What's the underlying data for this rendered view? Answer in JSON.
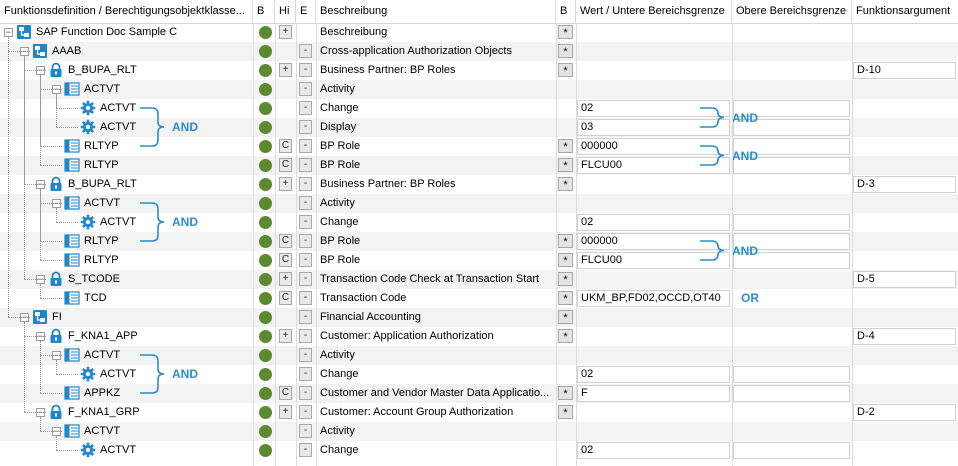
{
  "columns": {
    "name": "Funktionsdefinition / Berechtigungsobjektklasse...",
    "b": "B",
    "hi": "Hi",
    "e": "E",
    "desc": "Beschreibung",
    "b2": "B",
    "lower": "Wert / Untere Bereichsgrenze",
    "upper": "Obere Bereichsgrenze",
    "arg": "Funktionsargument"
  },
  "rows": [
    {
      "name": "SAP Function Doc Sample C",
      "icon": "function-icon",
      "level": 0,
      "hi": "+",
      "desc": "Beschreibung",
      "star": true,
      "lower": "",
      "upper": "",
      "arg": "",
      "lowerField": false,
      "upperField": false,
      "argField": false
    },
    {
      "name": "AAAB",
      "icon": "class-icon",
      "level": 1,
      "hi": "",
      "e": "-",
      "desc": "Cross-application Authorization Objects",
      "star": true
    },
    {
      "name": "B_BUPA_RLT",
      "icon": "lock-icon",
      "level": 2,
      "hi": "+",
      "e": "-",
      "desc": "Business Partner: BP Roles",
      "star": true,
      "arg": "D-10",
      "argField": true
    },
    {
      "name": "ACTVT",
      "icon": "field-icon",
      "level": 3,
      "e": "-",
      "desc": "Activity"
    },
    {
      "name": "ACTVT",
      "icon": "gear-icon",
      "level": 4,
      "e": "-",
      "desc": "Change",
      "lower": "02",
      "lowerField": true,
      "upperField": true
    },
    {
      "name": "ACTVT",
      "icon": "gear-icon",
      "level": 4,
      "e": "-",
      "desc": "Display",
      "lower": "03",
      "lowerField": true,
      "upperField": true
    },
    {
      "name": "RLTYP",
      "icon": "field-icon",
      "level": 3,
      "hi": "C",
      "e": "-",
      "desc": "BP Role",
      "star": true,
      "lower": "000000",
      "lowerField": true,
      "upperField": true
    },
    {
      "name": "RLTYP",
      "icon": "field-icon",
      "level": 3,
      "hi": "C",
      "e": "-",
      "desc": "BP Role",
      "star": true,
      "lower": "FLCU00",
      "lowerField": true,
      "upperField": true
    },
    {
      "name": "B_BUPA_RLT",
      "icon": "lock-icon",
      "level": 2,
      "hi": "+",
      "e": "-",
      "desc": "Business Partner: BP Roles",
      "star": true,
      "arg": "D-3",
      "argField": true
    },
    {
      "name": "ACTVT",
      "icon": "field-icon",
      "level": 3,
      "e": "-",
      "desc": "Activity"
    },
    {
      "name": "ACTVT",
      "icon": "gear-icon",
      "level": 4,
      "e": "-",
      "desc": "Change",
      "lower": "02",
      "lowerField": true,
      "upperField": true
    },
    {
      "name": "RLTYP",
      "icon": "field-icon",
      "level": 3,
      "hi": "C",
      "e": "-",
      "desc": "BP Role",
      "star": true,
      "lower": "000000",
      "lowerField": true,
      "upperField": true
    },
    {
      "name": "RLTYP",
      "icon": "field-icon",
      "level": 3,
      "hi": "C",
      "e": "-",
      "desc": "BP Role",
      "star": true,
      "lower": "FLCU00",
      "lowerField": true,
      "upperField": true
    },
    {
      "name": "S_TCODE",
      "icon": "lock-icon",
      "level": 2,
      "hi": "+",
      "e": "-",
      "desc": "Transaction Code Check at Transaction Start",
      "star": true,
      "arg": "D-5",
      "argField": true
    },
    {
      "name": "TCD",
      "icon": "field-icon",
      "level": 3,
      "hi": "C",
      "e": "-",
      "desc": "Transaction Code",
      "star": true,
      "lower": "UKM_BP,FD02,OCCD,OT40",
      "lowerField": true
    },
    {
      "name": "FI",
      "icon": "class-icon",
      "level": 1,
      "e": "-",
      "desc": "Financial Accounting",
      "star": true
    },
    {
      "name": "F_KNA1_APP",
      "icon": "lock-icon",
      "level": 2,
      "hi": "+",
      "e": "-",
      "desc": "Customer: Application Authorization",
      "star": true,
      "arg": "D-4",
      "argField": true
    },
    {
      "name": "ACTVT",
      "icon": "field-icon",
      "level": 3,
      "e": "-",
      "desc": "Activity"
    },
    {
      "name": "ACTVT",
      "icon": "gear-icon",
      "level": 4,
      "e": "-",
      "desc": "Change",
      "lower": "02",
      "lowerField": true,
      "upperField": true
    },
    {
      "name": "APPKZ",
      "icon": "field-icon",
      "level": 3,
      "hi": "C",
      "e": "-",
      "desc": "Customer and Vendor Master Data Applicatio...",
      "star": true,
      "lower": "F",
      "lowerField": true,
      "upperField": true
    },
    {
      "name": "F_KNA1_GRP",
      "icon": "lock-icon",
      "level": 2,
      "hi": "+",
      "e": "-",
      "desc": "Customer: Account Group Authorization",
      "star": true,
      "arg": "D-2",
      "argField": true
    },
    {
      "name": "ACTVT",
      "icon": "field-icon",
      "level": 3,
      "e": "-",
      "desc": "Activity"
    },
    {
      "name": "ACTVT",
      "icon": "gear-icon",
      "level": 4,
      "e": "-",
      "desc": "Change",
      "lower": "02",
      "lowerField": true,
      "upperField": true
    }
  ],
  "annotations": {
    "and": "AND",
    "or": "OR",
    "color": "#2a8fc8"
  },
  "colors": {
    "status_dot": "#5b8a2f",
    "icon_blue": "#1f86c8"
  }
}
